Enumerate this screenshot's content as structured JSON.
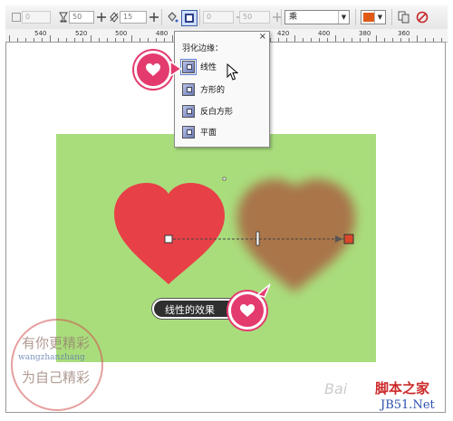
{
  "toolbar": {
    "fields": [
      {
        "value": "0",
        "disabled": true
      },
      {
        "value": "50",
        "disabled": false
      },
      {
        "value": "15",
        "disabled": false
      },
      {
        "value": "0",
        "disabled": true
      },
      {
        "value": "50",
        "disabled": true
      }
    ],
    "blend_mode": "乘",
    "fill_color": "#e05a16",
    "icons": [
      "checkbox-icon",
      "goblet-icon",
      "diamond-icon",
      "paint-bucket-icon",
      "feather-icon",
      "freeze-icon",
      "clear-icon"
    ]
  },
  "ruler": {
    "labels": [
      "540",
      "520",
      "500",
      "480",
      "420",
      "400",
      "380",
      "360"
    ]
  },
  "feather_menu": {
    "title": "羽化边缘：",
    "close": "×",
    "items": [
      {
        "label": "线性",
        "selected": true
      },
      {
        "label": "方形的",
        "selected": false
      },
      {
        "label": "反白方形",
        "selected": false
      },
      {
        "label": "平面",
        "selected": false
      }
    ]
  },
  "canvas": {
    "page_color": "#a9dd7c",
    "heart_color": "#e84047",
    "feathered_heart_color": "#a9744a",
    "end_handle_color": "#d9482a"
  },
  "callout": {
    "label": "线性的效果",
    "badge_icon": "heart-icon"
  },
  "watermark": {
    "line1": "有你更精彩",
    "line2": "wangzhanzhang",
    "line3": "为自己精彩",
    "baidu": "Bai",
    "site_name": "脚本之家",
    "site_url": "JB51.Net"
  }
}
